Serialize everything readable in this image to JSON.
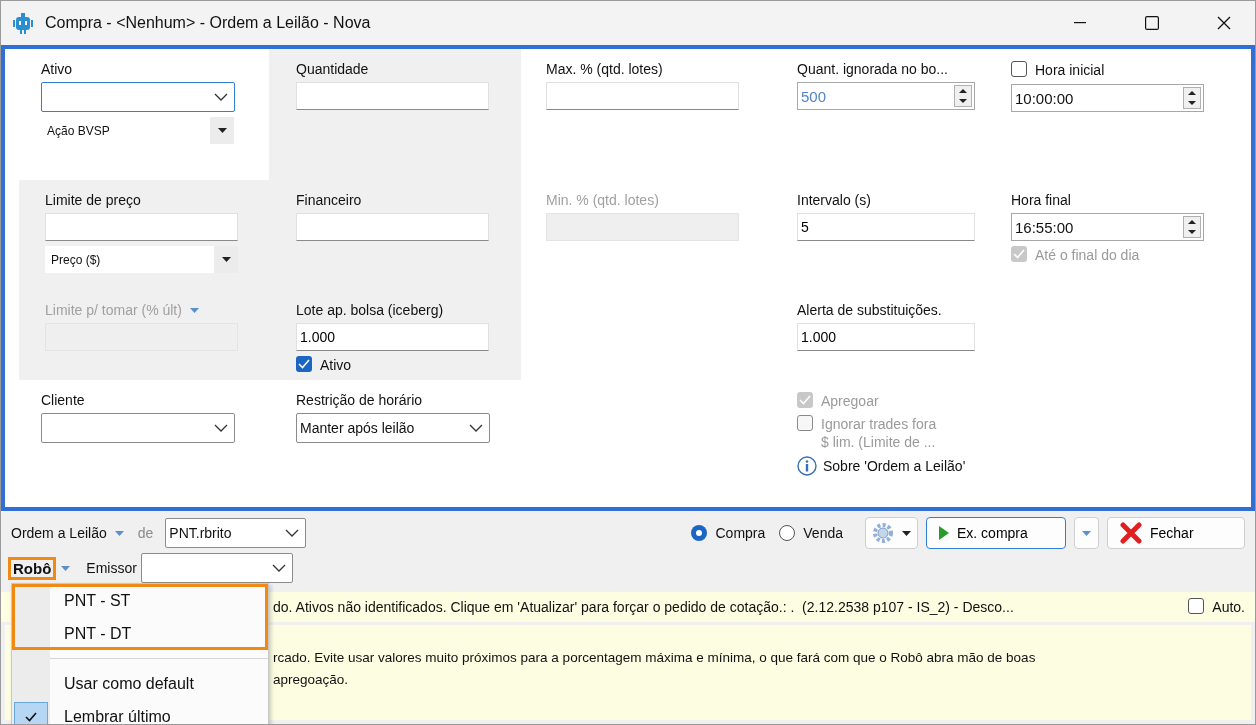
{
  "window": {
    "title": "Compra - <Nenhum> - Ordem a Leilão - Nova"
  },
  "form": {
    "cells": [
      {
        "label": {
          "kind": "plain",
          "text": "Ativo"
        },
        "controls": [
          {
            "kind": "combo",
            "focused": true
          },
          {
            "kind": "select",
            "value": "Ação BVSP"
          }
        ]
      },
      {
        "label": {
          "kind": "plain",
          "text": "Quantidade"
        },
        "controls": [
          {
            "kind": "text"
          }
        ]
      },
      {
        "label": {
          "kind": "plain",
          "text": "Max. % (qtd. lotes)"
        },
        "controls": [
          {
            "kind": "text"
          }
        ]
      },
      {
        "label": {
          "kind": "plain",
          "text": "Quant. ignorada no bo..."
        },
        "controls": [
          {
            "kind": "spin",
            "value": "500"
          }
        ]
      },
      {
        "label": {
          "kind": "checkbox",
          "text": "Hora inicial",
          "checked": false
        },
        "controls": [
          {
            "kind": "spin",
            "value": "10:00:00"
          }
        ]
      },
      {
        "label": {
          "kind": "plain",
          "text": "Limite de preço"
        },
        "controls": [
          {
            "kind": "text"
          },
          {
            "kind": "select",
            "value": "Preço ($)"
          }
        ]
      },
      {
        "label": {
          "kind": "plain",
          "text": "Financeiro"
        },
        "controls": [
          {
            "kind": "text"
          }
        ]
      },
      {
        "label": {
          "kind": "plain",
          "text": "Min. % (qtd. lotes)",
          "disabled": true
        },
        "controls": [
          {
            "kind": "text",
            "disabled": true
          }
        ]
      },
      {
        "label": {
          "kind": "plain",
          "text": "Intervalo (s)"
        },
        "controls": [
          {
            "kind": "text",
            "value": "5"
          }
        ]
      },
      {
        "label": {
          "kind": "plain",
          "text": "Hora final"
        },
        "controls": [
          {
            "kind": "spin",
            "value": "16:55:00"
          },
          {
            "kind": "checkbox",
            "text": "Até o final do dia",
            "checked": true,
            "disabled": true
          }
        ]
      },
      {
        "label": {
          "kind": "menu",
          "text": "Limite p/ tomar (% últ)",
          "disabled": true
        },
        "controls": [
          {
            "kind": "text",
            "disabled": true
          }
        ]
      },
      {
        "label": {
          "kind": "plain",
          "text": "Lote ap. bolsa (iceberg)"
        },
        "controls": [
          {
            "kind": "text",
            "value": "1.000"
          },
          {
            "kind": "checkbox",
            "text": "Ativo",
            "checked": true
          }
        ]
      },
      {
        "label": {
          "kind": "plain",
          "text": "Alerta de substituições."
        },
        "controls": [
          {
            "kind": "text",
            "value": "1.000"
          }
        ]
      },
      {
        "label": {
          "kind": "plain",
          "text": "Cliente"
        },
        "controls": [
          {
            "kind": "combo"
          }
        ]
      },
      {
        "label": {
          "kind": "plain",
          "text": "Restrição de horário"
        },
        "controls": [
          {
            "kind": "combo",
            "value": "Manter após leilão"
          }
        ]
      },
      {
        "controls": [
          {
            "kind": "checkbox",
            "text": "Apregoar",
            "checked": true,
            "disabled": true
          },
          {
            "kind": "checkbox",
            "text": "Ignorar trades fora\n$ lim. (Limite de ...",
            "checked": false,
            "disabled": true
          },
          {
            "kind": "info",
            "text": "Sobre 'Ordem a Leilão'"
          }
        ]
      }
    ]
  },
  "toolbar": {
    "strategy": "Ordem a Leilão",
    "from_label": "de",
    "account": "PNT.rbrito",
    "sides": [
      {
        "label": "Compra",
        "selected": true
      },
      {
        "label": "Venda",
        "selected": false
      }
    ],
    "execute_button": "Ex. compra",
    "close_button": "Fechar",
    "robot": {
      "label": "Robô",
      "highlighted": true
    },
    "issuer_label": "Emissor"
  },
  "status_bar": {
    "text": "do. Ativos não identificados. Clique em 'Atualizar' para forçar o pedido de cotação.: .  (2.12.2538 p107 - IS_2) - Desco...",
    "auto": {
      "label": "Auto.",
      "checked": false
    }
  },
  "info_text": "rcado. Evite usar valores muito próximos para a porcentagem máxima e mínima, o que fará com que o Robô abra mão de boas\napregoação.",
  "robot_menu": {
    "groups": [
      {
        "highlighted": true,
        "items": [
          {
            "label": "PNT - ST",
            "checked": false
          },
          {
            "label": "PNT - DT",
            "checked": false
          }
        ]
      },
      {
        "highlighted": false,
        "items": [
          {
            "label": "Usar como default",
            "checked": false
          },
          {
            "label": "Lembrar último",
            "checked": true
          }
        ]
      }
    ]
  }
}
